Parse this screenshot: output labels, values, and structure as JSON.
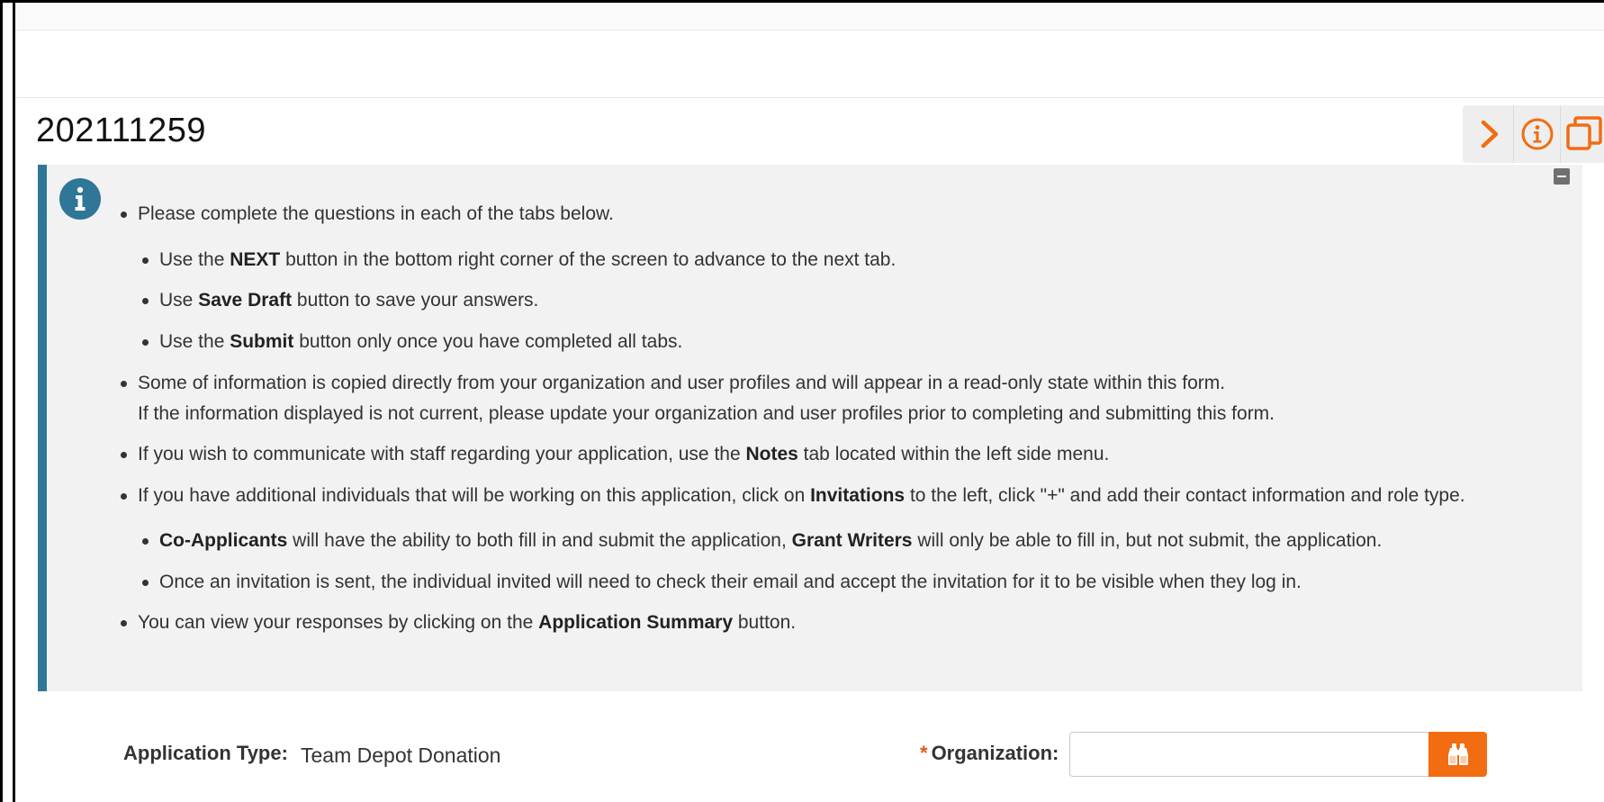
{
  "page": {
    "title": "202111259"
  },
  "actions": [
    {
      "icon": "chevron-right-icon"
    },
    {
      "icon": "info-circle-icon"
    },
    {
      "icon": "copy-icon"
    }
  ],
  "colors": {
    "accent": "#f26c12",
    "info_bar": "#2f7699",
    "panel_bg": "#f2f2f2"
  },
  "instructions": {
    "intro": "Please complete the questions in each of the tabs below.",
    "next_pre": "Use the ",
    "next_bold": "NEXT",
    "next_post": " button in the bottom right corner of the screen to advance to the next tab.",
    "save_pre": "Use ",
    "save_bold": "Save Draft",
    "save_post": " button to save your answers.",
    "submit_pre": "Use the ",
    "submit_bold": "Submit",
    "submit_post": " button only once you have completed all tabs.",
    "info_copied_1": "Some of information is copied directly from your organization and user profiles and will appear in a read-only state within this form.",
    "info_copied_2": "If the information displayed is not current, please update your organization and user profiles prior to completing and submitting this form.",
    "notes_pre": "If you wish to communicate with staff regarding your application, use the ",
    "notes_bold": "Notes",
    "notes_post": " tab located within the left side menu.",
    "inv_pre": "If you have additional individuals that will be working on this application, click on ",
    "inv_bold": "Invitations",
    "inv_post": " to the left, click \"+\" and add their contact information and role type.",
    "coapp_bold": "Co-Applicants",
    "coapp_mid": " will have the ability to both fill in and submit the application, ",
    "gw_bold": "Grant Writers",
    "coapp_post": " will only be able to fill in, but not submit, the application.",
    "invsent": "Once an invitation is sent, the individual invited will need to check their email and accept the invitation for it to be visible when they log in.",
    "summary_pre": "You can view your responses by clicking on the ",
    "summary_bold": "Application Summary",
    "summary_post": " button."
  },
  "form": {
    "application_type_label": "Application Type:",
    "application_type_value": "Team Depot Donation",
    "organization_required_marker": "*",
    "organization_label": "Organization:",
    "organization_value": ""
  }
}
